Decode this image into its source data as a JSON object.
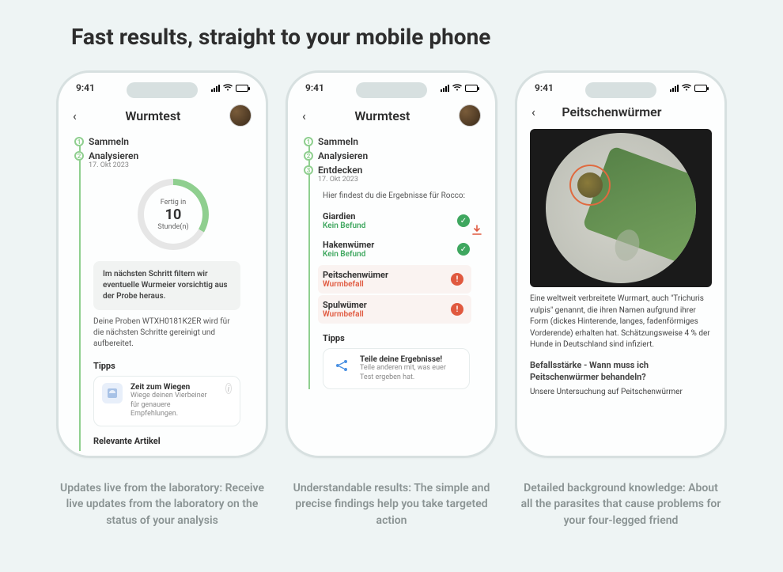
{
  "heading": "Fast results, straight to your mobile phone",
  "common": {
    "time": "9:41"
  },
  "phone1": {
    "nav_title": "Wurmtest",
    "steps": {
      "s1": {
        "num": "1",
        "label": "Sammeln"
      },
      "s2": {
        "num": "2",
        "label": "Analysieren",
        "date": "17. Okt 2023"
      }
    },
    "ring": {
      "top": "Fertig in",
      "value": "10",
      "unit": "Stunde(n)"
    },
    "next_step": "Im nächsten Schritt filtern wir eventuelle Wurmeier vorsichtig aus der Probe heraus.",
    "sample_text": "Deine Proben WTXH0181K2ER wird für die nächsten Schritte gereinigt und aufbereitet.",
    "tips_title": "Tipps",
    "tip": {
      "title": "Zeit zum Wiegen",
      "desc": "Wiege deinen Vierbeiner für genauere Empfehlungen."
    },
    "articles_title": "Relevante Artikel"
  },
  "phone2": {
    "nav_title": "Wurmtest",
    "steps": {
      "s1": {
        "num": "1",
        "label": "Sammeln"
      },
      "s2": {
        "num": "2",
        "label": "Analysieren"
      },
      "s3": {
        "num": "3",
        "label": "Entdecken",
        "date": "17. Okt 2023"
      }
    },
    "intro": "Hier findest du die Ergebnisse für Rocco:",
    "results": {
      "r1": {
        "name": "Giardien",
        "status": "Kein Befund"
      },
      "r2": {
        "name": "Hakenwümer",
        "status": "Kein Befund"
      },
      "r3": {
        "name": "Peitschenwümer",
        "status": "Wurmbefall"
      },
      "r4": {
        "name": "Spulwümer",
        "status": "Wurmbefall"
      }
    },
    "tips_title": "Tipps",
    "share": {
      "title": "Teile deine Ergebnisse!",
      "desc": "Teile anderen mit, was euer Test ergeben hat."
    }
  },
  "phone3": {
    "nav_title": "Peitschenwürmer",
    "p1": "Eine weltweit verbreitete Wurmart, auch \"Trichuris vulpis\" genannt, die ihren Namen aufgrund ihrer Form (dickes Hinterende, langes, fadenförmiges Vorderende) erhalten hat. Schätzungsweise 4 % der Hunde in Deutschland sind infiziert.",
    "h2": "Befallsstärke - Wann muss ich Peitschenwürmer behandeln?",
    "p2": "Unsere Untersuchung auf Peitschenwürmer"
  },
  "captions": {
    "c1": "Updates live from the laboratory: Receive live updates from the laboratory on the status of your analysis",
    "c2": "Understandable results: The simple and precise findings help you take targeted action",
    "c3": "Detailed background knowledge: About all the parasites that cause problems for your four-legged friend"
  }
}
